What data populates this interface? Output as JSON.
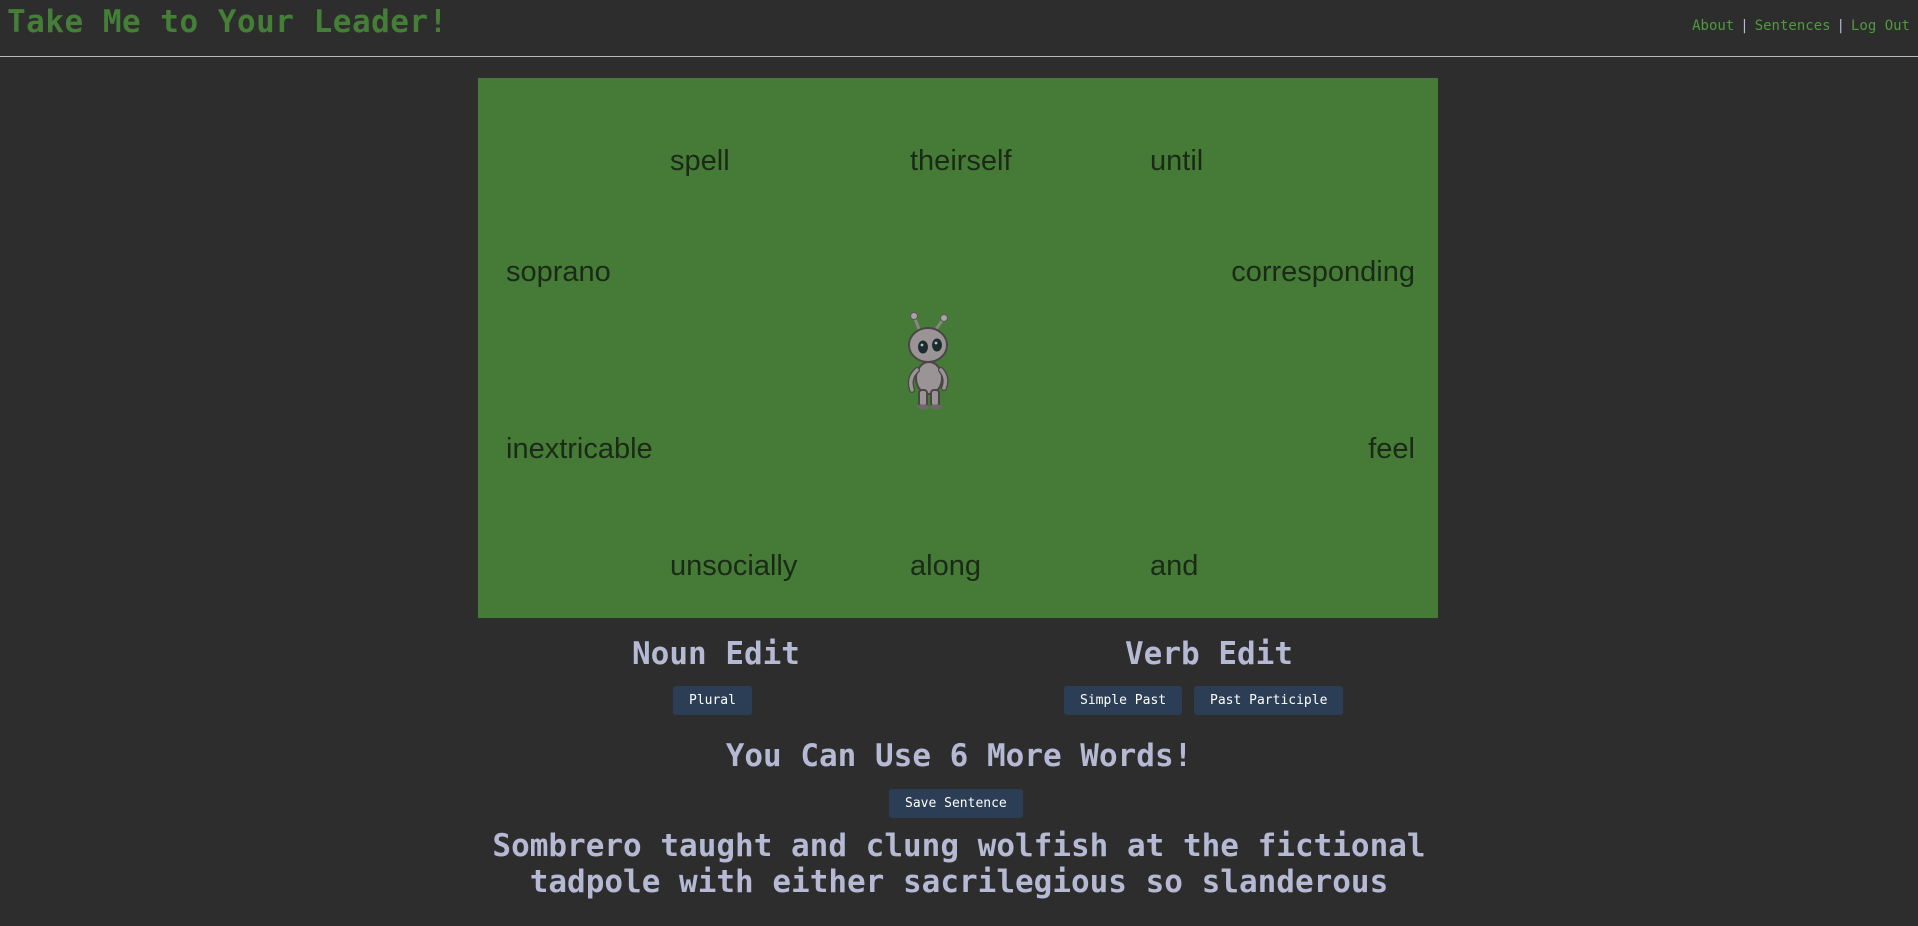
{
  "header": {
    "title": "Take Me to Your Leader!",
    "nav": {
      "about": "About",
      "separator": "|",
      "sentences": "Sentences",
      "logout": "Log Out"
    }
  },
  "game": {
    "background_color": "#457b36",
    "words": {
      "top_left": "spell",
      "top_center": "theirself",
      "top_right": "until",
      "upper_left": "soprano",
      "upper_right": "corresponding",
      "lower_left": "inextricable",
      "lower_right": "feel",
      "bottom_left": "unsocially",
      "bottom_center": "along",
      "bottom_right": "and"
    },
    "player": "alien-character"
  },
  "noun_edit": {
    "title": "Noun Edit",
    "plural_label": "Plural"
  },
  "verb_edit": {
    "title": "Verb Edit",
    "simple_past_label": "Simple Past",
    "past_participle_label": "Past Participle"
  },
  "status": {
    "words_remaining_text": "You Can Use 6 More Words!",
    "save_label": "Save Sentence"
  },
  "sentence": {
    "line1": "Sombrero taught and clung wolfish at the fictional",
    "line2": "tadpole with either sacrilegious so slanderous"
  },
  "colors": {
    "page_background": "#2d2d2d",
    "accent_green": "#457e37",
    "text_lavender": "#b5b9d3",
    "button_navy": "#2b3e55"
  }
}
